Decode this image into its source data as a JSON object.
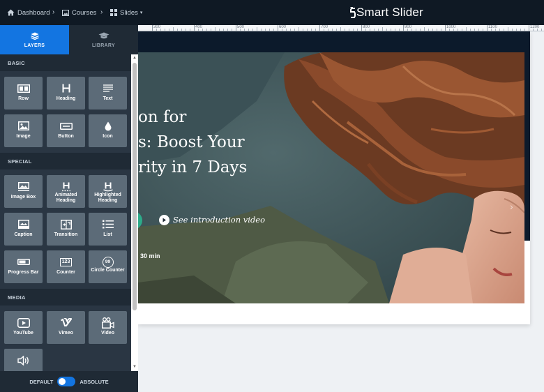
{
  "topbar": {
    "dashboard_label": "Dashboard",
    "courses_label": "Courses",
    "slides_label": "Slides",
    "logo_text": "Smart Slider"
  },
  "ruler": {
    "ticks": [
      "300",
      "400",
      "500",
      "600",
      "700",
      "800",
      "900",
      "1000",
      "1100",
      "1200"
    ]
  },
  "sidebar": {
    "tabs": [
      {
        "label": "LAYERS",
        "icon": "layers-icon",
        "active": true
      },
      {
        "label": "LIBRARY",
        "icon": "graduation-cap-icon",
        "active": false
      }
    ],
    "sections": [
      {
        "title": "BASIC",
        "items": [
          {
            "label": "Row",
            "icon": "row-icon"
          },
          {
            "label": "Heading",
            "icon": "heading-icon"
          },
          {
            "label": "Text",
            "icon": "text-icon"
          },
          {
            "label": "Image",
            "icon": "image-icon"
          },
          {
            "label": "Button",
            "icon": "button-icon"
          },
          {
            "label": "Icon",
            "icon": "drop-icon"
          }
        ]
      },
      {
        "title": "SPECIAL",
        "items": [
          {
            "label": "Image Box",
            "icon": "image-box-icon"
          },
          {
            "label": "Animated Heading",
            "icon": "animated-heading-icon"
          },
          {
            "label": "Highlighted Heading",
            "icon": "highlighted-heading-icon"
          },
          {
            "label": "Caption",
            "icon": "caption-icon"
          },
          {
            "label": "Transition",
            "icon": "transition-icon"
          },
          {
            "label": "List",
            "icon": "list-icon"
          },
          {
            "label": "Progress Bar",
            "icon": "progress-bar-icon"
          },
          {
            "label": "Counter",
            "icon": "counter-icon"
          },
          {
            "label": "Circle Counter",
            "icon": "circle-counter-icon"
          }
        ]
      },
      {
        "title": "MEDIA",
        "items": [
          {
            "label": "YouTube",
            "icon": "youtube-icon"
          },
          {
            "label": "Vimeo",
            "icon": "vimeo-icon"
          },
          {
            "label": "Video",
            "icon": "video-icon"
          },
          {
            "label": "",
            "icon": "audio-icon"
          }
        ]
      }
    ],
    "counter_icon_text": "123",
    "circle_counter_icon_text": "99",
    "mode_left": "DEFAULT",
    "mode_right": "ABSOLUTE"
  },
  "slide": {
    "title_lines": [
      "on for",
      "s: Boost Your",
      "rity in 7 Days"
    ],
    "video_link": "See introduction video",
    "duration": "30 min",
    "dots": 3,
    "active_dot": 0
  },
  "colors": {
    "accent": "#1375e1",
    "topbar": "#0f1924",
    "sidebar": "#1f2a35",
    "tile": "#5c6b78",
    "cta_green": "#2dab8a"
  }
}
